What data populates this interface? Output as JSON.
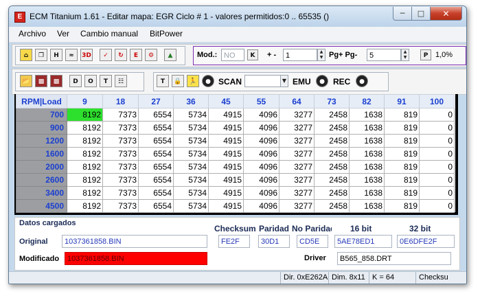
{
  "window": {
    "title": "ECM Titanium 1.61 - Editar mapa: EGR Ciclo # 1 - valores permitidos:0 .. 65535 ()",
    "app_icon_letter": "E"
  },
  "menu": [
    "Archivo",
    "Ver",
    "Cambio manual",
    "BitPower"
  ],
  "toolbar1": {
    "mod_label": "Mod.:",
    "mod_placeholder": "NO",
    "k_button": "K",
    "plusminus_label": "+ -",
    "step_value": "1",
    "pg_label": "Pg+ Pg-",
    "pg_value": "5",
    "p_button": "P",
    "percent_value": "1,0%"
  },
  "toolbar2": {
    "scan_label": "SCAN",
    "scan_value": "",
    "emu_label": "EMU",
    "rec_label": "REC"
  },
  "grid": {
    "corner": "RPM|Load",
    "columns": [
      "9",
      "18",
      "27",
      "36",
      "45",
      "55",
      "64",
      "73",
      "82",
      "91",
      "100"
    ],
    "rows": [
      {
        "rpm": "700",
        "values": [
          "8192",
          "7373",
          "6554",
          "5734",
          "4915",
          "4096",
          "3277",
          "2458",
          "1638",
          "819",
          "0"
        ]
      },
      {
        "rpm": "900",
        "values": [
          "8192",
          "7373",
          "6554",
          "5734",
          "4915",
          "4096",
          "3277",
          "2458",
          "1638",
          "819",
          "0"
        ]
      },
      {
        "rpm": "1200",
        "values": [
          "8192",
          "7373",
          "6554",
          "5734",
          "4915",
          "4096",
          "3277",
          "2458",
          "1638",
          "819",
          "0"
        ]
      },
      {
        "rpm": "1600",
        "values": [
          "8192",
          "7373",
          "6554",
          "5734",
          "4915",
          "4096",
          "3277",
          "2458",
          "1638",
          "819",
          "0"
        ]
      },
      {
        "rpm": "2000",
        "values": [
          "8192",
          "7373",
          "6554",
          "5734",
          "4915",
          "4096",
          "3277",
          "2458",
          "1638",
          "819",
          "0"
        ]
      },
      {
        "rpm": "2600",
        "values": [
          "8192",
          "7373",
          "6554",
          "5734",
          "4915",
          "4096",
          "3277",
          "2458",
          "1638",
          "819",
          "0"
        ]
      },
      {
        "rpm": "3400",
        "values": [
          "8192",
          "7373",
          "6554",
          "5734",
          "4915",
          "4096",
          "3277",
          "2458",
          "1638",
          "819",
          "0"
        ]
      },
      {
        "rpm": "4500",
        "values": [
          "8192",
          "7373",
          "6554",
          "5734",
          "4915",
          "4096",
          "3277",
          "2458",
          "1638",
          "819",
          "0"
        ]
      }
    ],
    "selected_color": "#2ee02e"
  },
  "info": {
    "section_title": "Datos cargados",
    "checksum_label": "Checksum",
    "paridad_label": "Paridad",
    "no_paridad_label": "No Paridad",
    "bit16_label": "16 bit",
    "bit32_label": "32 bit",
    "original_label": "Original",
    "original_file": "1037361858.BIN",
    "checksum_value": "FE2F",
    "paridad_value": "30D1",
    "no_paridad_value": "CD5E",
    "bit16_value": "5AE78ED1",
    "bit32_value": "0E6DFE2F",
    "modificado_label": "Modificado",
    "modificado_file": "1037361858.BIN",
    "modificado_color": "#ff0000",
    "driver_label": "Driver",
    "driver_value": "B565_858.DRT"
  },
  "status": {
    "dir": "Dir. 0xE262A",
    "dim": "Dim. 8x11",
    "k": "K = 64",
    "checksum": "Checksu"
  }
}
